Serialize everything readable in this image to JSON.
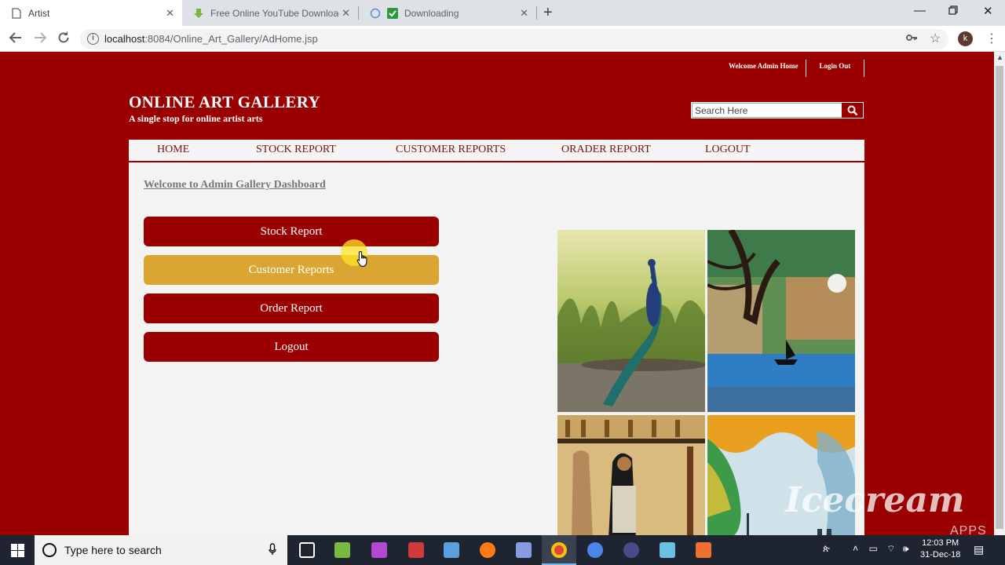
{
  "browser": {
    "tabs": [
      {
        "title": "Artist",
        "icon": "page-icon",
        "active": true
      },
      {
        "title": "Free Online YouTube Downloade",
        "icon": "download-favicon-icon",
        "active": false
      },
      {
        "title": "Downloading",
        "icon": "check-favicon-icon",
        "active": false
      }
    ],
    "url_host": "localhost",
    "url_rest": ":8084/Online_Art_Gallery/AdHome.jsp"
  },
  "site": {
    "top_links": [
      "Welcome Admin Home",
      "Login Out"
    ],
    "title": "ONLINE ART GALLERY",
    "tagline": "A single stop for online artist arts",
    "search_placeholder": "Search Here",
    "nav": [
      "HOME",
      "STOCK REPORT",
      "CUSTOMER REPORTS",
      "ORADER REPORT",
      "LOGOUT"
    ],
    "welcome": "Welcome to Admin Gallery Dashboard",
    "buttons": [
      "Stock Report",
      "Customer Reports",
      "Order Report",
      "Logout"
    ]
  },
  "colors": {
    "brand_red": "#9b0000",
    "highlight_gold": "#dba531"
  },
  "taskbar": {
    "search_placeholder": "Type here to search",
    "time": "12:03 PM",
    "date": "31-Dec-18"
  },
  "watermark": {
    "text": "Icecream",
    "sub": "APPS"
  }
}
